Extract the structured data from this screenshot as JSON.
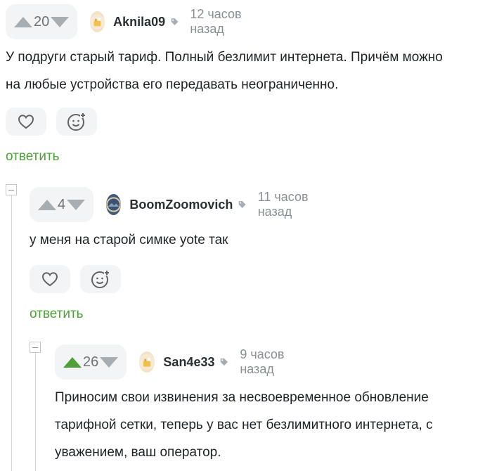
{
  "comments": [
    {
      "votes": "20",
      "username": "Aknila09",
      "time": "12 часов назад",
      "lines": [
        "У подруги старый тариф. Полный безлимит интернета. Причём можно",
        "на любые устройства его передавать неограниченно."
      ],
      "reply_label": "ответить",
      "upvoted": false
    },
    {
      "votes": "4",
      "username": "BoomZoomovich",
      "time": "11 часов назад",
      "lines": [
        "у меня на старой симке yote так"
      ],
      "reply_label": "ответить",
      "upvoted": false
    },
    {
      "votes": "26",
      "username": "San4e33",
      "time": "9 часов назад",
      "lines": [
        "Приносим свои извинения за несвоевременное обновление",
        "тарифной сетки, теперь у вас нет безлимитного интернета, с",
        "уважением, ваш оператор."
      ],
      "upvoted": true
    }
  ],
  "icons": {
    "upvote": "arrow-up-icon",
    "downvote": "arrow-down-icon",
    "like": "heart-icon",
    "react": "emoji-add-icon",
    "tag": "tag-icon",
    "collapse": "minus-icon"
  },
  "colors": {
    "accent_green": "#4fa03a",
    "pill_bg": "#f2f4f5",
    "muted": "#8a8f94"
  }
}
